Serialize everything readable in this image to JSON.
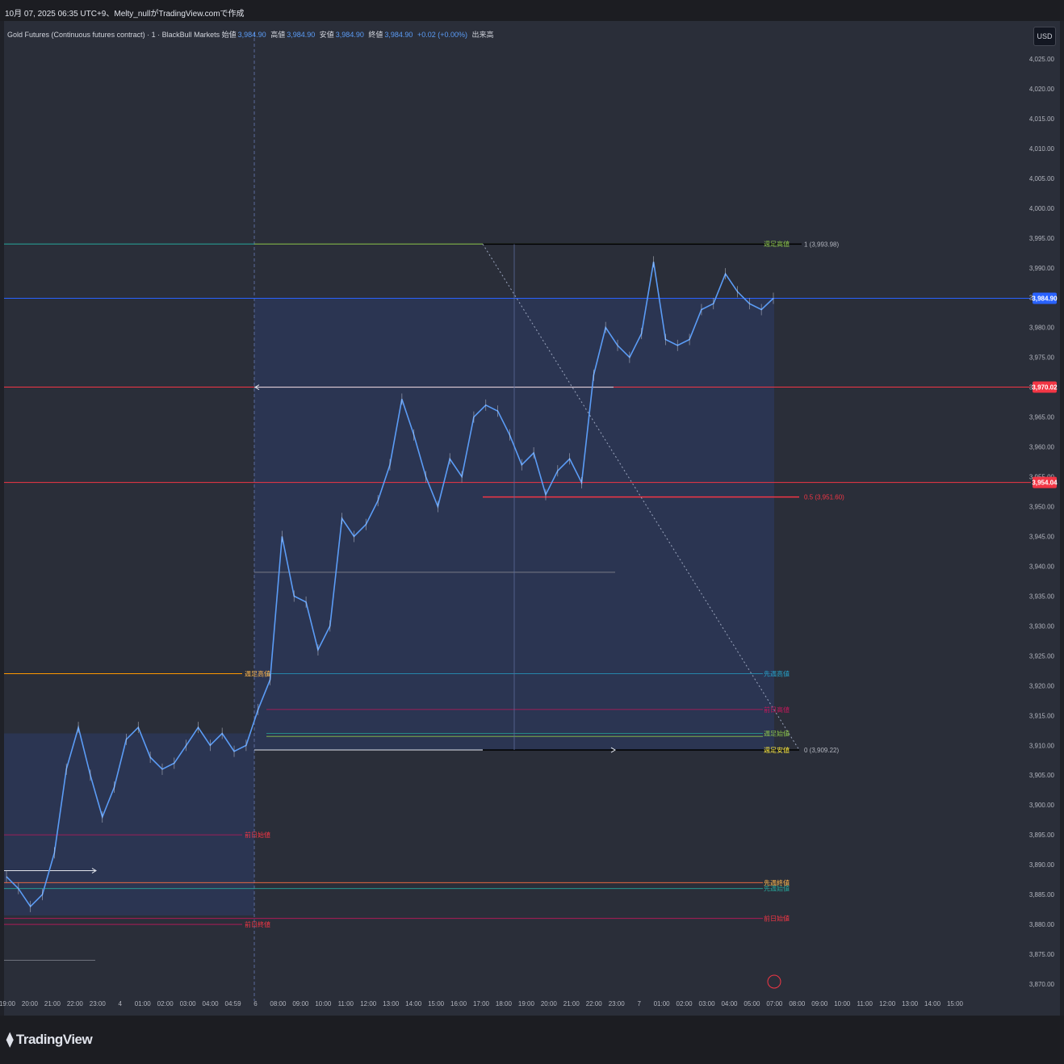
{
  "header": {
    "snapshot_text": "10月 07, 2025 06:35 UTC+9、Melty_nullがTradingView.comで作成"
  },
  "legend": {
    "symbol": "Gold Futures (Continuous futures contract) · 1 · BlackBull Markets",
    "open_label": "始値",
    "open": "3,984.90",
    "high_label": "高値",
    "high": "3,984.90",
    "low_label": "安値",
    "low": "3,984.90",
    "close_label": "終値",
    "close": "3,984.90",
    "change": "+0.02 (+0.00%)",
    "volume_label": "出来高"
  },
  "currency": "USD",
  "brand": "TradingView",
  "colors": {
    "candle": "#5b9cf6",
    "current_price": "#2962ff",
    "red_level": "#f23645",
    "zone": "#2c3f70"
  },
  "chart_data": {
    "type": "line",
    "instrument": "Gold Futures",
    "timeframe": "1",
    "ylim": [
      3867,
      4029
    ],
    "y_ticks": [
      3870,
      3875,
      3880,
      3885,
      3890,
      3895,
      3900,
      3905,
      3910,
      3915,
      3920,
      3925,
      3930,
      3935,
      3940,
      3945,
      3950,
      3955,
      3960,
      3965,
      3970,
      3975,
      3980,
      3985,
      3990,
      3995,
      4000,
      4005,
      4010,
      4015,
      4020,
      4025
    ],
    "x_ticks": [
      "19:00",
      "20:00",
      "21:00",
      "22:00",
      "23:00",
      "4",
      "01:00",
      "02:00",
      "03:00",
      "04:00",
      "04:59",
      "6",
      "08:00",
      "09:00",
      "10:00",
      "11:00",
      "12:00",
      "13:00",
      "14:00",
      "15:00",
      "16:00",
      "17:00",
      "18:00",
      "19:00",
      "20:00",
      "21:00",
      "22:00",
      "23:00",
      "7",
      "01:00",
      "02:00",
      "03:00",
      "04:00",
      "05:00",
      "07:00",
      "08:00",
      "09:00",
      "10:00",
      "11:00",
      "12:00",
      "13:00",
      "14:00",
      "15:00"
    ],
    "price_path": [
      [
        0,
        3888
      ],
      [
        1,
        3886
      ],
      [
        2,
        3883
      ],
      [
        3,
        3885
      ],
      [
        4,
        3892
      ],
      [
        5,
        3906
      ],
      [
        6,
        3913
      ],
      [
        7,
        3905
      ],
      [
        8,
        3898
      ],
      [
        9,
        3903
      ],
      [
        10,
        3911
      ],
      [
        11,
        3913
      ],
      [
        12,
        3908
      ],
      [
        13,
        3906
      ],
      [
        14,
        3907
      ],
      [
        15,
        3910
      ],
      [
        16,
        3913
      ],
      [
        17,
        3910
      ],
      [
        18,
        3912
      ],
      [
        19,
        3909
      ],
      [
        20,
        3910
      ],
      [
        21,
        3916
      ],
      [
        22,
        3921
      ],
      [
        23,
        3945
      ],
      [
        24,
        3935
      ],
      [
        25,
        3934
      ],
      [
        26,
        3926
      ],
      [
        27,
        3930
      ],
      [
        28,
        3948
      ],
      [
        29,
        3945
      ],
      [
        30,
        3947
      ],
      [
        31,
        3951
      ],
      [
        32,
        3957
      ],
      [
        33,
        3968
      ],
      [
        34,
        3962
      ],
      [
        35,
        3955
      ],
      [
        36,
        3950
      ],
      [
        37,
        3958
      ],
      [
        38,
        3955
      ],
      [
        39,
        3965
      ],
      [
        40,
        3967
      ],
      [
        41,
        3966
      ],
      [
        42,
        3962
      ],
      [
        43,
        3957
      ],
      [
        44,
        3959
      ],
      [
        45,
        3952
      ],
      [
        46,
        3956
      ],
      [
        47,
        3958
      ],
      [
        48,
        3954
      ],
      [
        49,
        3972
      ],
      [
        50,
        3980
      ],
      [
        51,
        3977
      ],
      [
        52,
        3975
      ],
      [
        53,
        3979
      ],
      [
        54,
        3991
      ],
      [
        55,
        3978
      ],
      [
        56,
        3977
      ],
      [
        57,
        3978
      ],
      [
        58,
        3983
      ],
      [
        59,
        3984
      ],
      [
        60,
        3989
      ],
      [
        61,
        3986
      ],
      [
        62,
        3984
      ],
      [
        63,
        3983
      ],
      [
        64,
        3984.9
      ]
    ],
    "current_price": "3,984.90",
    "levels": [
      {
        "price": 3970.02,
        "label": "3,970.02"
      },
      {
        "price": 3954.04,
        "label": "3,954.04"
      }
    ],
    "fib": [
      {
        "level": "1",
        "value": "(3,993.98)"
      },
      {
        "level": "0.5",
        "value": "(3,951.60)"
      },
      {
        "level": "0",
        "value": "(3,909.22)"
      }
    ],
    "annotations": {
      "weekly_high_right": "週足高値",
      "weekly_high_left": "週足高値",
      "last_week_high": "先週高値",
      "prev_day_high": "前日高値",
      "weekly_open": "週足始値",
      "weekly_low": "週足安値",
      "prev_day_open": "前日始値",
      "prev_day_close": "前日終値",
      "last_week_close": "先週終値",
      "last_week_open": "先週始値",
      "prev_day_open_right": "前日始値"
    }
  }
}
